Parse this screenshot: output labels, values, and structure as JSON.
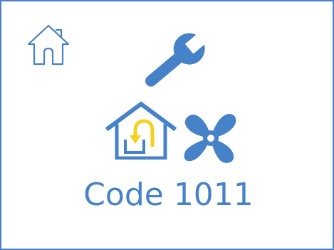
{
  "colors": {
    "primary": "#4682c8",
    "accent": "#f5d020",
    "background": "#ffffff"
  },
  "icons": {
    "home": "home-icon",
    "wrench": "wrench-icon",
    "house_return": "house-return-icon",
    "fan": "fan-icon"
  },
  "status": {
    "code_text": "Code 1011"
  }
}
